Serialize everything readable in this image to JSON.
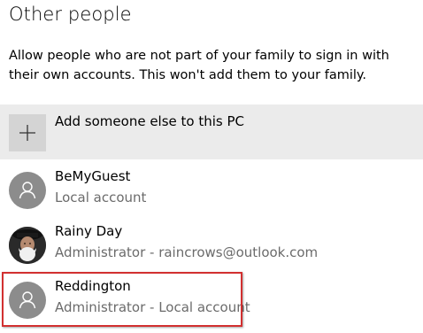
{
  "section": {
    "title": "Other people",
    "description": "Allow people who are not part of your family to sign in with their own accounts. This won't add them to your family."
  },
  "add_someone": {
    "label": "Add someone else to this PC",
    "icon": "plus-icon"
  },
  "accounts": [
    {
      "name": "BeMyGuest",
      "subtitle": "Local account",
      "avatar": "person-icon"
    },
    {
      "name": "Rainy Day",
      "subtitle": "Administrator - raincrows@outlook.com",
      "avatar": "user-photo"
    },
    {
      "name": "Reddington",
      "subtitle": "Administrator - Local account",
      "avatar": "person-icon",
      "highlighted": true
    }
  ],
  "colors": {
    "add_row_bg": "#ebebeb",
    "add_tile_bg": "#d4d4d4",
    "avatar_bg": "#8c8c8c",
    "secondary_text": "#6b6b6b",
    "highlight_border": "#d23030"
  }
}
